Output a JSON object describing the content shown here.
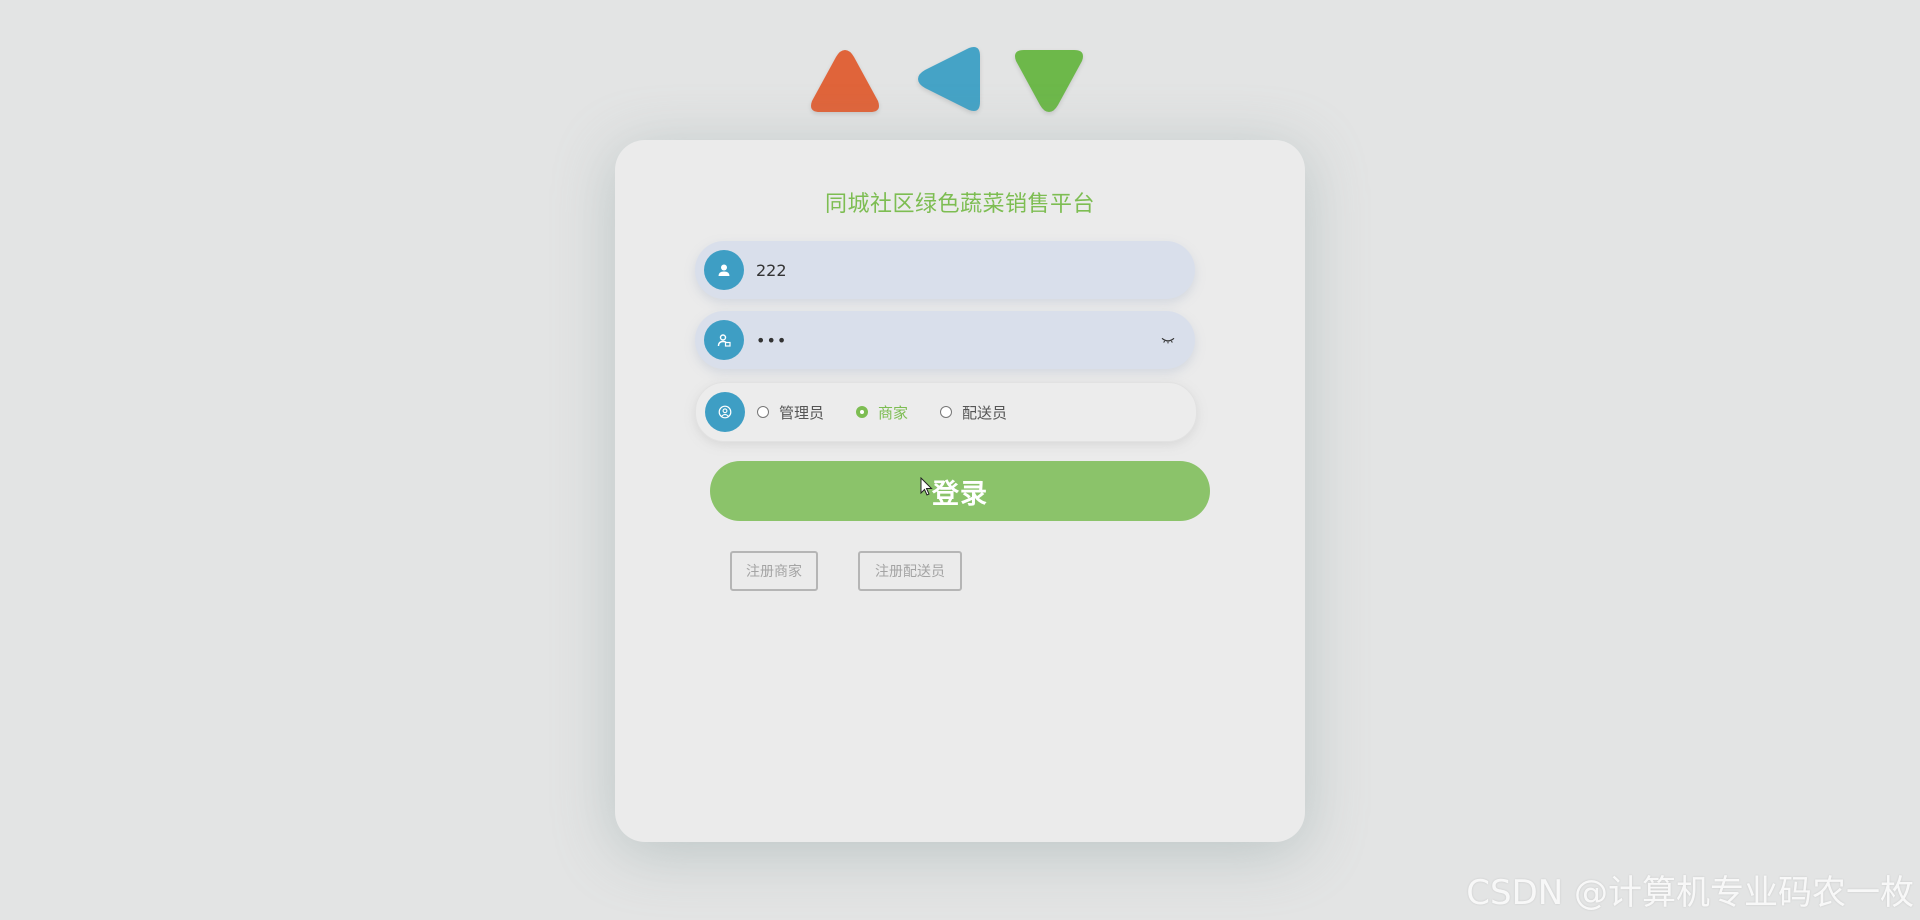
{
  "app": {
    "title": "同城社区绿色蔬菜销售平台"
  },
  "form": {
    "username": {
      "value": "222",
      "icon": "user-icon"
    },
    "password": {
      "value": "•••",
      "icon": "id-card-icon",
      "toggle_icon": "eye-closed-icon"
    },
    "role": {
      "icon": "user-circle-icon",
      "options": [
        {
          "label": "管理员",
          "checked": false
        },
        {
          "label": "商家",
          "checked": true
        },
        {
          "label": "配送员",
          "checked": false
        }
      ]
    },
    "login_label": "登录",
    "register_merchant_label": "注册商家",
    "register_courier_label": "注册配送员"
  },
  "watermark": "CSDN @计算机专业码农一枚",
  "colors": {
    "accent_green": "#7dbd52",
    "button_green": "#8bc36a",
    "icon_blue": "#3e9ec4",
    "tri_orange": "#e0643a",
    "tri_blue": "#45a3c6",
    "tri_green": "#6db84a"
  }
}
